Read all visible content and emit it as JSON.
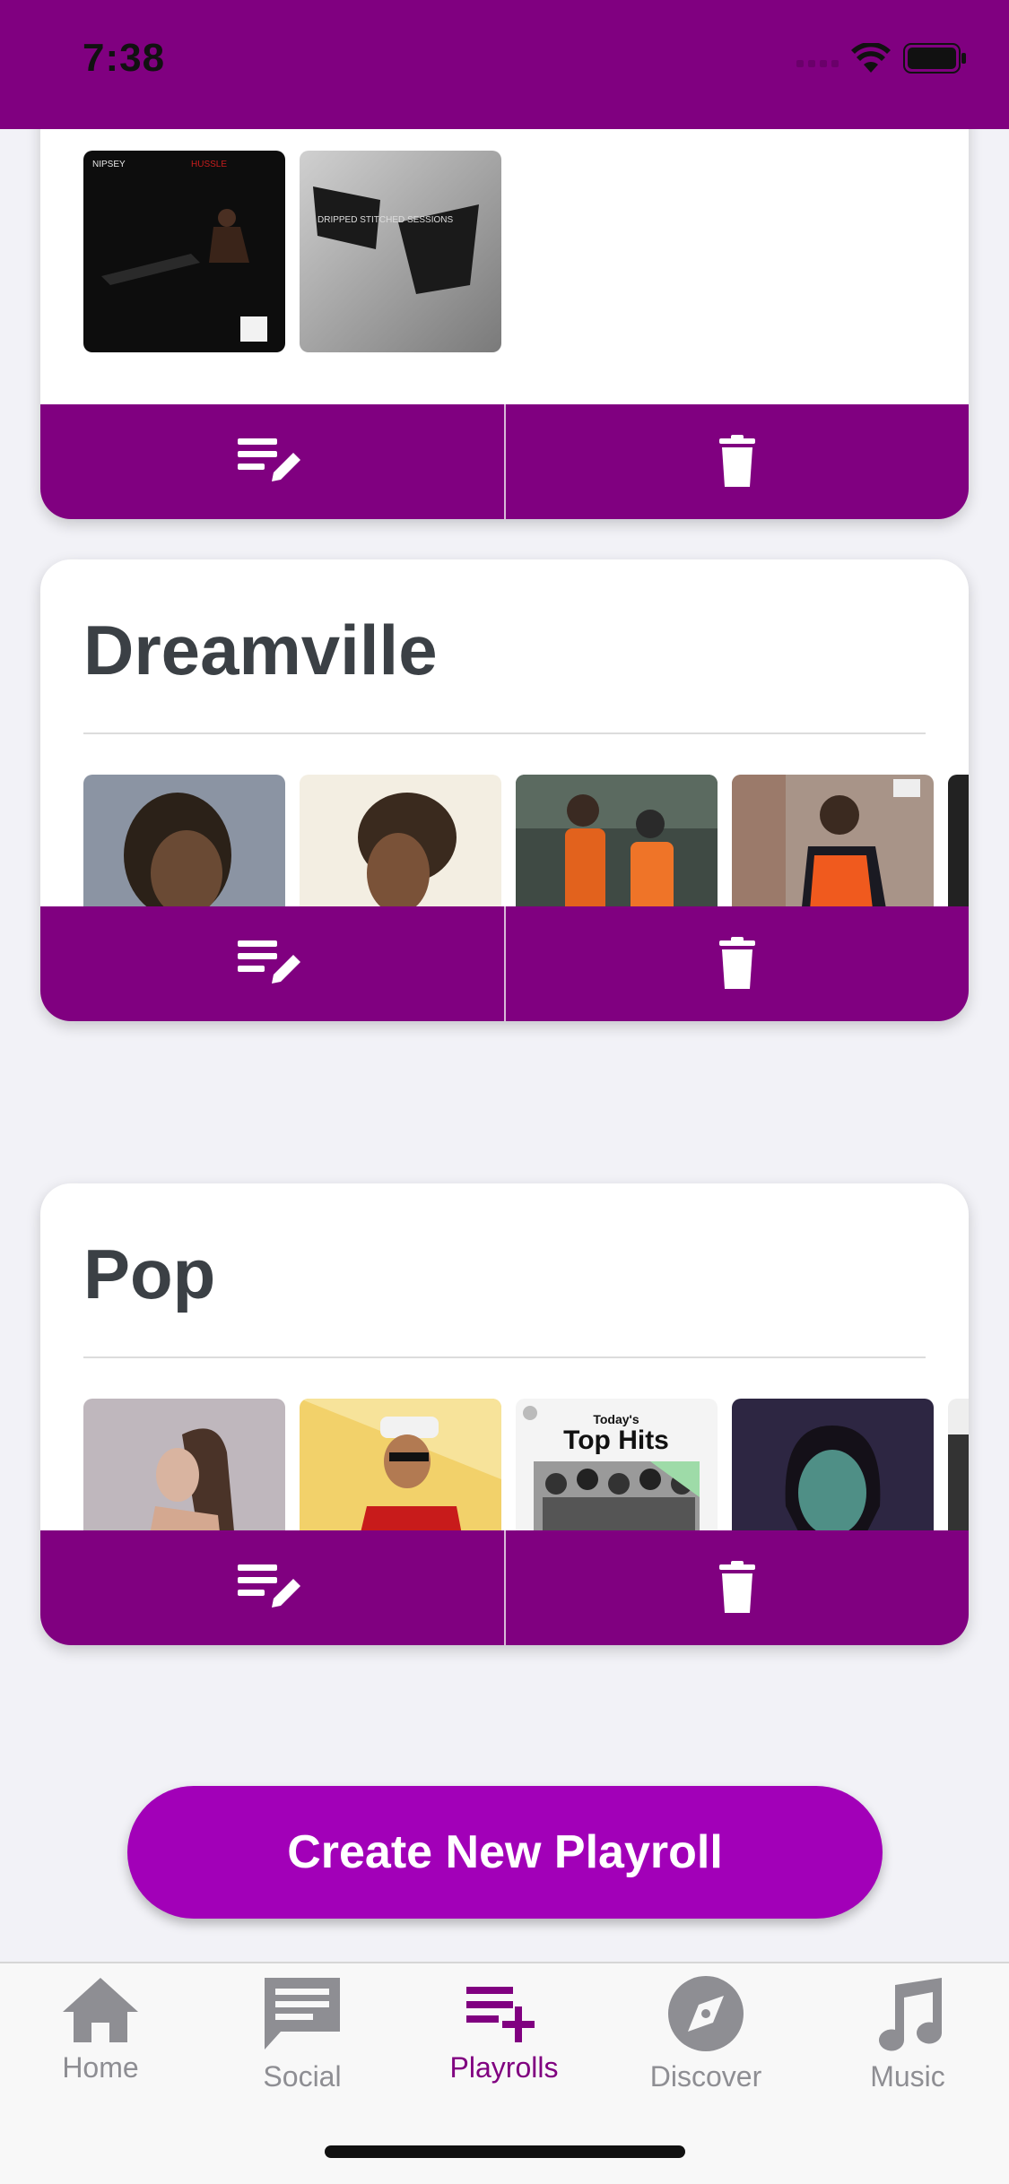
{
  "status_bar": {
    "time": "7:38"
  },
  "playlists": [
    {
      "name": "",
      "thumbs": [
        "nipsey-hussle-album-cover",
        "dripped-stitched-sessions-cover"
      ]
    },
    {
      "name": "Dreamville",
      "thumbs": [
        "j-cole-portrait",
        "bas-portrait",
        "artists-orange-jumpsuits",
        "jid-orange-vest",
        "partial-cover-bw"
      ]
    },
    {
      "name": "Pop",
      "thumbs": [
        "ariana-grande-portrait",
        "bruno-mars-portrait",
        "todays-top-hits-cover",
        "dua-lipa-portrait",
        "partial-cover"
      ]
    }
  ],
  "cover_texts": {
    "nipsey_a": "NIPSEY",
    "nipsey_b": "HUSSLE",
    "dripped": "DRIPPED STITCHED SESSIONS",
    "tth_small": "Today's",
    "tth_big": "Top Hits"
  },
  "actions": {
    "edit_icon": "edit-playlist-icon",
    "delete_icon": "trash-icon"
  },
  "create_button": {
    "label": "Create New Playroll"
  },
  "tabs": [
    {
      "label": "Home",
      "icon": "home-icon",
      "active": false
    },
    {
      "label": "Social",
      "icon": "chat-icon",
      "active": false
    },
    {
      "label": "Playrolls",
      "icon": "playlist-add-icon",
      "active": true
    },
    {
      "label": "Discover",
      "icon": "compass-icon",
      "active": false
    },
    {
      "label": "Music",
      "icon": "music-note-icon",
      "active": false
    }
  ],
  "colors": {
    "brand": "#800080",
    "button": "#a200b8",
    "inactive": "#8e8e93"
  }
}
